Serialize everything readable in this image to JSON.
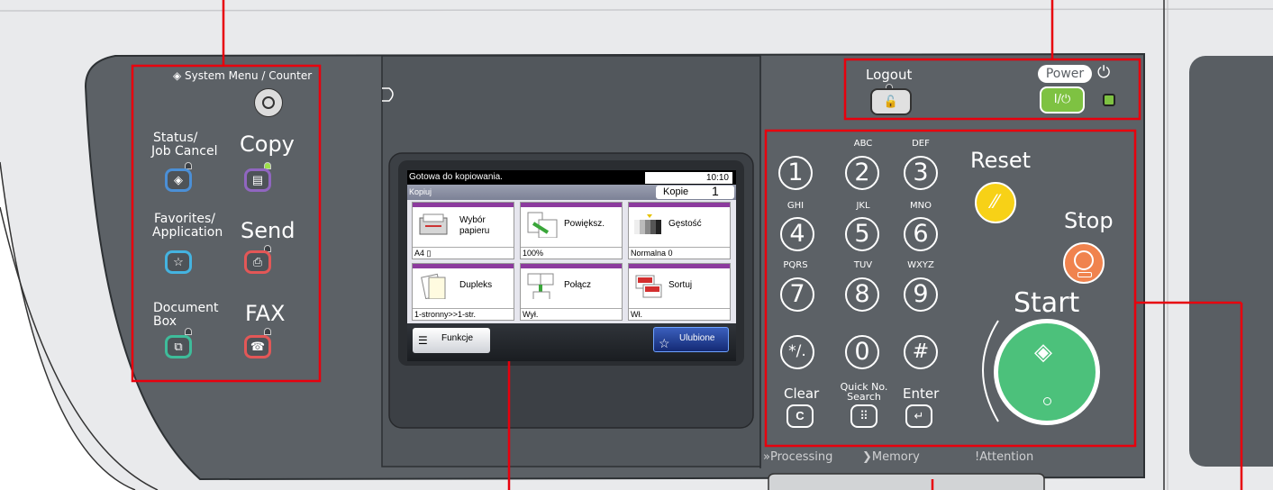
{
  "panel_left": {
    "system_menu_label": "System Menu / Counter",
    "status_label_1": "Status/",
    "status_label_2": "Job Cancel",
    "copy_label": "Copy",
    "favorites_label_1": "Favorites/",
    "favorites_label_2": "Application",
    "send_label": "Send",
    "docbox_label_1": "Document",
    "docbox_label_2": "Box",
    "fax_label": "FAX"
  },
  "top_right": {
    "logout_label": "Logout",
    "power_label": "Power",
    "power_key_label": "I/⏻"
  },
  "keypad": {
    "keys": [
      {
        "digit": "1",
        "letters": ""
      },
      {
        "digit": "2",
        "letters": "ABC"
      },
      {
        "digit": "3",
        "letters": "DEF"
      },
      {
        "digit": "4",
        "letters": "GHI"
      },
      {
        "digit": "5",
        "letters": "JKL"
      },
      {
        "digit": "6",
        "letters": "MNO"
      },
      {
        "digit": "7",
        "letters": "PQRS"
      },
      {
        "digit": "8",
        "letters": "TUV"
      },
      {
        "digit": "9",
        "letters": "WXYZ"
      }
    ],
    "star_label": "*/.",
    "zero_label": "0",
    "hash_label": "#",
    "clear_label": "Clear",
    "clear_key": "C",
    "quick_label_1": "Quick No.",
    "quick_label_2": "Search",
    "enter_label": "Enter",
    "reset_label": "Reset",
    "stop_label": "Stop",
    "start_label": "Start"
  },
  "indicators": {
    "processing": "»Processing",
    "memory": "Memory",
    "attention": "!Attention"
  },
  "screen": {
    "status_text": "Gotowa do kopiowania.",
    "clock": "10:10",
    "mode": "Kopiuj",
    "copies_label": "Kopie",
    "copies_value": "1",
    "tiles": [
      {
        "name_1": "Wybór",
        "name_2": "papieru",
        "value": "A4"
      },
      {
        "name_1": "Powiększ.",
        "name_2": "",
        "value": "100%"
      },
      {
        "name_1": "Gęstość",
        "name_2": "",
        "value": "Normalna 0"
      },
      {
        "name_1": "Dupleks",
        "name_2": "",
        "value": "1-stronny>>1-str."
      },
      {
        "name_1": "Połącz",
        "name_2": "",
        "value": "Wył."
      },
      {
        "name_1": "Sortuj",
        "name_2": "",
        "value": "Wł."
      }
    ],
    "functions_label": "Funkcje",
    "favorites_label": "Ulubione"
  },
  "colors": {
    "panel": "#5c6166",
    "body": "#e9eaec",
    "callout": "#e8000d",
    "start": "#4cc17b",
    "stop": "#f0834e",
    "reset": "#f7d117",
    "power_key": "#7ec242"
  }
}
